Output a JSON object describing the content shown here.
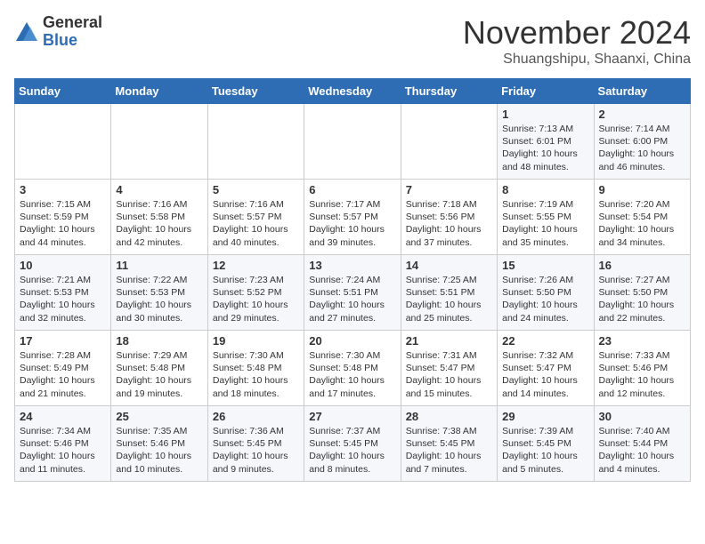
{
  "logo": {
    "general": "General",
    "blue": "Blue"
  },
  "header": {
    "month": "November 2024",
    "location": "Shuangshipu, Shaanxi, China"
  },
  "weekdays": [
    "Sunday",
    "Monday",
    "Tuesday",
    "Wednesday",
    "Thursday",
    "Friday",
    "Saturday"
  ],
  "weeks": [
    [
      {
        "day": "",
        "info": ""
      },
      {
        "day": "",
        "info": ""
      },
      {
        "day": "",
        "info": ""
      },
      {
        "day": "",
        "info": ""
      },
      {
        "day": "",
        "info": ""
      },
      {
        "day": "1",
        "info": "Sunrise: 7:13 AM\nSunset: 6:01 PM\nDaylight: 10 hours and 48 minutes."
      },
      {
        "day": "2",
        "info": "Sunrise: 7:14 AM\nSunset: 6:00 PM\nDaylight: 10 hours and 46 minutes."
      }
    ],
    [
      {
        "day": "3",
        "info": "Sunrise: 7:15 AM\nSunset: 5:59 PM\nDaylight: 10 hours and 44 minutes."
      },
      {
        "day": "4",
        "info": "Sunrise: 7:16 AM\nSunset: 5:58 PM\nDaylight: 10 hours and 42 minutes."
      },
      {
        "day": "5",
        "info": "Sunrise: 7:16 AM\nSunset: 5:57 PM\nDaylight: 10 hours and 40 minutes."
      },
      {
        "day": "6",
        "info": "Sunrise: 7:17 AM\nSunset: 5:57 PM\nDaylight: 10 hours and 39 minutes."
      },
      {
        "day": "7",
        "info": "Sunrise: 7:18 AM\nSunset: 5:56 PM\nDaylight: 10 hours and 37 minutes."
      },
      {
        "day": "8",
        "info": "Sunrise: 7:19 AM\nSunset: 5:55 PM\nDaylight: 10 hours and 35 minutes."
      },
      {
        "day": "9",
        "info": "Sunrise: 7:20 AM\nSunset: 5:54 PM\nDaylight: 10 hours and 34 minutes."
      }
    ],
    [
      {
        "day": "10",
        "info": "Sunrise: 7:21 AM\nSunset: 5:53 PM\nDaylight: 10 hours and 32 minutes."
      },
      {
        "day": "11",
        "info": "Sunrise: 7:22 AM\nSunset: 5:53 PM\nDaylight: 10 hours and 30 minutes."
      },
      {
        "day": "12",
        "info": "Sunrise: 7:23 AM\nSunset: 5:52 PM\nDaylight: 10 hours and 29 minutes."
      },
      {
        "day": "13",
        "info": "Sunrise: 7:24 AM\nSunset: 5:51 PM\nDaylight: 10 hours and 27 minutes."
      },
      {
        "day": "14",
        "info": "Sunrise: 7:25 AM\nSunset: 5:51 PM\nDaylight: 10 hours and 25 minutes."
      },
      {
        "day": "15",
        "info": "Sunrise: 7:26 AM\nSunset: 5:50 PM\nDaylight: 10 hours and 24 minutes."
      },
      {
        "day": "16",
        "info": "Sunrise: 7:27 AM\nSunset: 5:50 PM\nDaylight: 10 hours and 22 minutes."
      }
    ],
    [
      {
        "day": "17",
        "info": "Sunrise: 7:28 AM\nSunset: 5:49 PM\nDaylight: 10 hours and 21 minutes."
      },
      {
        "day": "18",
        "info": "Sunrise: 7:29 AM\nSunset: 5:48 PM\nDaylight: 10 hours and 19 minutes."
      },
      {
        "day": "19",
        "info": "Sunrise: 7:30 AM\nSunset: 5:48 PM\nDaylight: 10 hours and 18 minutes."
      },
      {
        "day": "20",
        "info": "Sunrise: 7:30 AM\nSunset: 5:48 PM\nDaylight: 10 hours and 17 minutes."
      },
      {
        "day": "21",
        "info": "Sunrise: 7:31 AM\nSunset: 5:47 PM\nDaylight: 10 hours and 15 minutes."
      },
      {
        "day": "22",
        "info": "Sunrise: 7:32 AM\nSunset: 5:47 PM\nDaylight: 10 hours and 14 minutes."
      },
      {
        "day": "23",
        "info": "Sunrise: 7:33 AM\nSunset: 5:46 PM\nDaylight: 10 hours and 12 minutes."
      }
    ],
    [
      {
        "day": "24",
        "info": "Sunrise: 7:34 AM\nSunset: 5:46 PM\nDaylight: 10 hours and 11 minutes."
      },
      {
        "day": "25",
        "info": "Sunrise: 7:35 AM\nSunset: 5:46 PM\nDaylight: 10 hours and 10 minutes."
      },
      {
        "day": "26",
        "info": "Sunrise: 7:36 AM\nSunset: 5:45 PM\nDaylight: 10 hours and 9 minutes."
      },
      {
        "day": "27",
        "info": "Sunrise: 7:37 AM\nSunset: 5:45 PM\nDaylight: 10 hours and 8 minutes."
      },
      {
        "day": "28",
        "info": "Sunrise: 7:38 AM\nSunset: 5:45 PM\nDaylight: 10 hours and 7 minutes."
      },
      {
        "day": "29",
        "info": "Sunrise: 7:39 AM\nSunset: 5:45 PM\nDaylight: 10 hours and 5 minutes."
      },
      {
        "day": "30",
        "info": "Sunrise: 7:40 AM\nSunset: 5:44 PM\nDaylight: 10 hours and 4 minutes."
      }
    ]
  ]
}
